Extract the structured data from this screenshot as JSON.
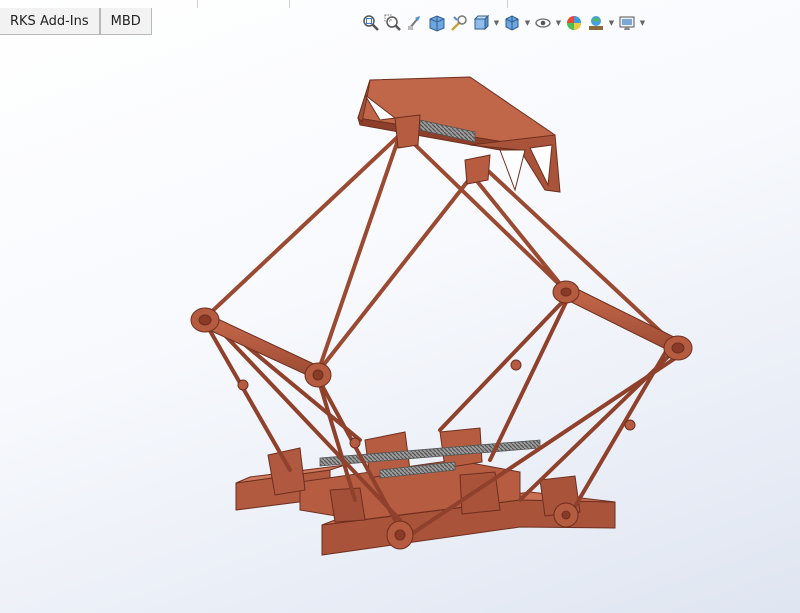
{
  "tabs": [
    {
      "label": "RKS Add-Ins"
    },
    {
      "label": "MBD"
    }
  ],
  "toolbar": {
    "icons": [
      {
        "name": "zoom-to-fit-icon"
      },
      {
        "name": "zoom-to-area-icon"
      },
      {
        "name": "previous-view-icon"
      },
      {
        "name": "section-view-icon"
      },
      {
        "name": "dynamic-annotation-icon"
      },
      {
        "name": "view-orientation-icon",
        "dropdown": true
      },
      {
        "name": "display-style-icon",
        "dropdown": true
      },
      {
        "name": "hide-show-items-icon",
        "dropdown": true
      },
      {
        "name": "edit-appearance-icon"
      },
      {
        "name": "apply-scene-icon",
        "dropdown": true
      },
      {
        "name": "view-settings-icon",
        "dropdown": true
      }
    ]
  },
  "colors": {
    "part": "#b0583f",
    "part_dark": "#7a3524",
    "part_light": "#cf7a5e",
    "spring": "#8c8c8c",
    "viewport_top": "#ffffff",
    "viewport_bottom": "#dfe5f1"
  }
}
